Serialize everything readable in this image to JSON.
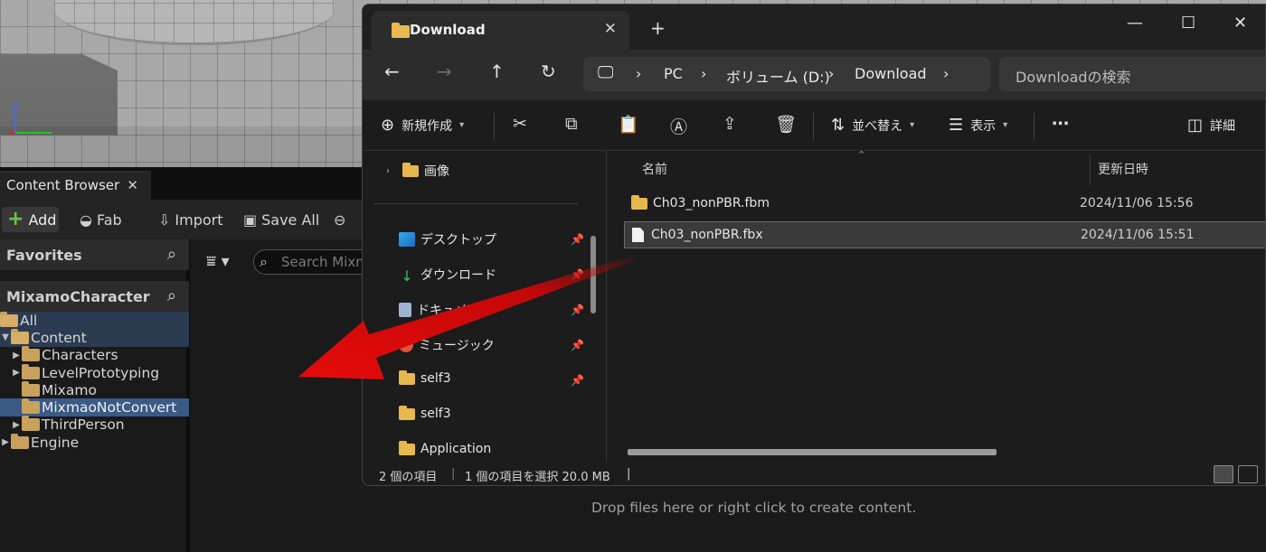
{
  "content_browser": {
    "tab_label": "Content Browser",
    "toolbar": {
      "add_label": "Add",
      "fab_label": "Fab",
      "import_label": "Import",
      "save_all_label": "Save All"
    },
    "favorites_label": "Favorites",
    "project_label": "MixamoCharacter",
    "tree": [
      {
        "label": "All",
        "depth": 0,
        "arrow": "",
        "open": true
      },
      {
        "label": "Content",
        "depth": 0,
        "arrow": "▼",
        "open": true
      },
      {
        "label": "Characters",
        "depth": 1,
        "arrow": "▶"
      },
      {
        "label": "LevelPrototyping",
        "depth": 1,
        "arrow": "▶"
      },
      {
        "label": "Mixamo",
        "depth": 1,
        "arrow": ""
      },
      {
        "label": "MixmaoNotConvert",
        "depth": 1,
        "arrow": "",
        "selected": true
      },
      {
        "label": "ThirdPerson",
        "depth": 1,
        "arrow": "▶"
      },
      {
        "label": "Engine",
        "depth": 0,
        "arrow": "▶"
      }
    ],
    "search_placeholder": "Search Mixm",
    "drop_hint": "Drop files here or right click to create content."
  },
  "explorer": {
    "tab_title": "Download",
    "address": {
      "pc": "PC",
      "volume": "ボリューム (D:)",
      "folder": "Download"
    },
    "search_placeholder": "Downloadの検索",
    "commands": {
      "new_label": "新規作成",
      "sort_label": "並べ替え",
      "view_label": "表示",
      "details_label": "詳細"
    },
    "nav_items": [
      {
        "label": "画像",
        "icon": "folder-icon",
        "pinned": false
      },
      {
        "label": "デスクトップ",
        "icon": "desktop-icon",
        "pinned": true
      },
      {
        "label": "ダウンロード",
        "icon": "download-icon",
        "pinned": true
      },
      {
        "label": "ドキュメント",
        "icon": "document-icon",
        "pinned": true
      },
      {
        "label": "ミュージック",
        "icon": "music-icon",
        "pinned": true
      },
      {
        "label": "self3",
        "icon": "folder-icon",
        "pinned": true
      },
      {
        "label": "self3",
        "icon": "folder-icon",
        "pinned": false
      },
      {
        "label": "Application",
        "icon": "folder-icon",
        "pinned": false
      }
    ],
    "columns": {
      "name": "名前",
      "modified": "更新日時"
    },
    "files": [
      {
        "name": "Ch03_nonPBR.fbm",
        "type": "folder",
        "modified": "2024/11/06 15:56"
      },
      {
        "name": "Ch03_nonPBR.fbx",
        "type": "file",
        "modified": "2024/11/06 15:51",
        "selected": true
      }
    ],
    "status": {
      "count": "2 個の項目",
      "selection": "1 個の項目を選択  20.0 MB"
    }
  },
  "colors": {
    "arrow": "#d80a0a",
    "selection_blue": "#3b5a86",
    "folder_yellow": "#e8b84e"
  }
}
